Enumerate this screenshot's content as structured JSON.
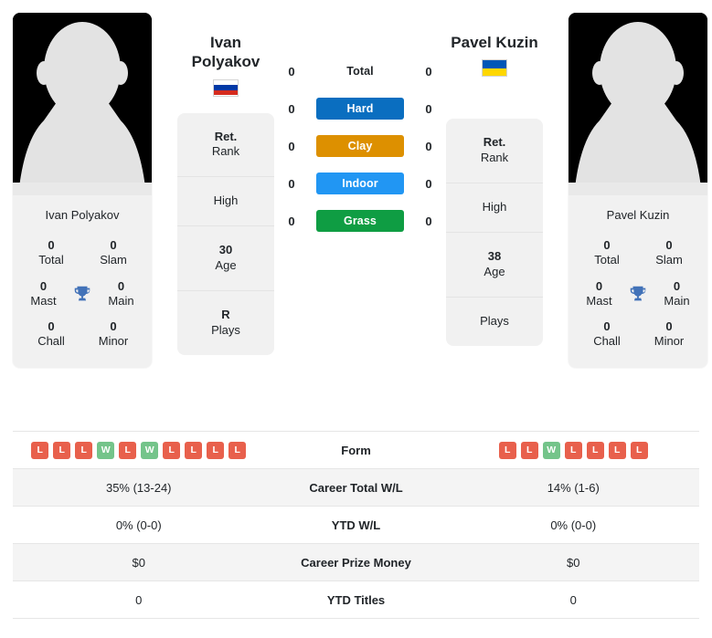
{
  "players": {
    "left": {
      "name": "Ivan Polyakov",
      "name_lines": [
        "Ivan",
        "Polyakov"
      ],
      "photo_name": "Ivan Polyakov",
      "country": "Russia",
      "flag_colors": [
        "#ffffff",
        "#0039a6",
        "#d52b1e"
      ],
      "titles": [
        {
          "value": "0",
          "label": "Total"
        },
        {
          "value": "0",
          "label": "Slam"
        },
        {
          "value": "0",
          "label": "Mast"
        },
        {
          "value": "0",
          "label": "Main"
        },
        {
          "value": "0",
          "label": "Chall"
        },
        {
          "value": "0",
          "label": "Minor"
        }
      ],
      "info": [
        {
          "value": "Ret.",
          "label": "Rank"
        },
        {
          "value": "",
          "label": "High"
        },
        {
          "value": "30",
          "label": "Age"
        },
        {
          "value": "R",
          "label": "Plays"
        }
      ],
      "surface_scores": [
        "0",
        "0",
        "0",
        "0",
        "0"
      ],
      "form": [
        "L",
        "L",
        "L",
        "W",
        "L",
        "W",
        "L",
        "L",
        "L",
        "L"
      ],
      "stats": [
        "35% (13-24)",
        "0% (0-0)",
        "$0",
        "0"
      ]
    },
    "right": {
      "name": "Pavel Kuzin",
      "name_lines": [
        "Pavel Kuzin"
      ],
      "photo_name": "Pavel Kuzin",
      "country": "Ukraine",
      "flag_colors": [
        "#0057b7",
        "#ffd700"
      ],
      "titles": [
        {
          "value": "0",
          "label": "Total"
        },
        {
          "value": "0",
          "label": "Slam"
        },
        {
          "value": "0",
          "label": "Mast"
        },
        {
          "value": "0",
          "label": "Main"
        },
        {
          "value": "0",
          "label": "Chall"
        },
        {
          "value": "0",
          "label": "Minor"
        }
      ],
      "info": [
        {
          "value": "Ret.",
          "label": "Rank"
        },
        {
          "value": "",
          "label": "High"
        },
        {
          "value": "38",
          "label": "Age"
        },
        {
          "value": "",
          "label": "Plays"
        }
      ],
      "surface_scores": [
        "0",
        "0",
        "0",
        "0",
        "0"
      ],
      "form": [
        "L",
        "L",
        "W",
        "L",
        "L",
        "L",
        "L"
      ],
      "stats": [
        "14% (1-6)",
        "0% (0-0)",
        "$0",
        "0"
      ]
    }
  },
  "surfaces": [
    {
      "label": "Total",
      "color": "transparent",
      "plain": true
    },
    {
      "label": "Hard",
      "color": "#0a6ec0",
      "plain": false
    },
    {
      "label": "Clay",
      "color": "#dd9000",
      "plain": false
    },
    {
      "label": "Indoor",
      "color": "#2196f3",
      "plain": false
    },
    {
      "label": "Grass",
      "color": "#0f9d43",
      "plain": false
    }
  ],
  "stats_rows": [
    {
      "label": "Form"
    },
    {
      "label": "Career Total W/L"
    },
    {
      "label": "YTD W/L"
    },
    {
      "label": "Career Prize Money"
    },
    {
      "label": "YTD Titles"
    }
  ],
  "icons": {
    "trophy": "trophy-icon",
    "avatar": "player-avatar-silhouette"
  }
}
